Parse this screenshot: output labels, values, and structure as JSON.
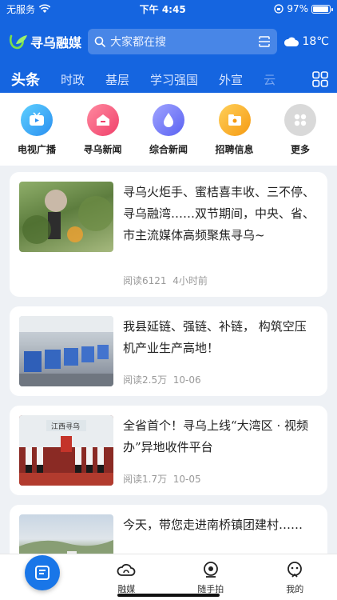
{
  "status_bar": {
    "carrier": "无服务",
    "time": "下午 4:45",
    "battery": "97%",
    "battery_level": 0.97
  },
  "header": {
    "brand": "寻乌融媒",
    "search_placeholder": "大家都在搜",
    "temperature": "18℃"
  },
  "tabs": [
    {
      "label": "头条",
      "active": true
    },
    {
      "label": "时政"
    },
    {
      "label": "基层"
    },
    {
      "label": "学习强国"
    },
    {
      "label": "外宣"
    },
    {
      "label": "云"
    }
  ],
  "channels": [
    {
      "label": "电视广播",
      "icon": "tv-icon",
      "color": "#38b6f4"
    },
    {
      "label": "寻乌新闻",
      "icon": "news-home-icon",
      "color": "#f5607a"
    },
    {
      "label": "综合新闻",
      "icon": "drop-icon",
      "color": "#7c7ff7"
    },
    {
      "label": "招聘信息",
      "icon": "folder-icon",
      "color": "#f7a521"
    },
    {
      "label": "更多",
      "icon": "more-icon",
      "color": "#dcdcdc"
    }
  ],
  "articles": [
    {
      "title": "寻乌火炬手、蜜桔喜丰收、三不停、寻乌融湾……双节期间，中央、省、市主流媒体高频聚焦寻乌~",
      "reads": "阅读6121",
      "time": "4小时前"
    },
    {
      "title": "我县延链、强链、补链， 构筑空压机产业生产高地！",
      "reads": "阅读2.5万",
      "time": "10-06"
    },
    {
      "title": "全省首个！寻乌上线“大湾区 · 视频办”异地收件平台",
      "reads": "阅读1.7万",
      "time": "10-05",
      "thumb_text": "江西寻乌"
    },
    {
      "title": "今天，带您走进南桥镇团建村……",
      "reads": "",
      "time": ""
    }
  ],
  "bottom_nav": [
    {
      "label": "",
      "icon": "home-news-icon"
    },
    {
      "label": "融媒",
      "icon": "cloud-icon"
    },
    {
      "label": "随手拍",
      "icon": "camera-icon"
    },
    {
      "label": "我的",
      "icon": "user-icon"
    }
  ],
  "colors": {
    "brand_blue": "#1565e0",
    "active_nav": "#1976e8"
  }
}
